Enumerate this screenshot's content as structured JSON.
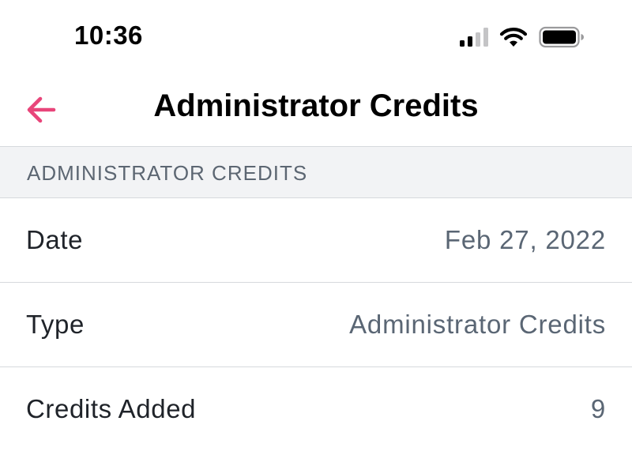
{
  "status_bar": {
    "time": "10:36",
    "icons": [
      "cellular-signal-icon",
      "wifi-icon",
      "battery-icon"
    ]
  },
  "nav": {
    "title": "Administrator Credits",
    "back_icon": "back-arrow-icon",
    "accent_color": "#e8457a"
  },
  "section": {
    "header": "ADMINISTRATOR CREDITS"
  },
  "details": [
    {
      "label": "Date",
      "value": "Feb 27, 2022"
    },
    {
      "label": "Type",
      "value": "Administrator Credits"
    },
    {
      "label": "Credits Added",
      "value": "9"
    }
  ]
}
